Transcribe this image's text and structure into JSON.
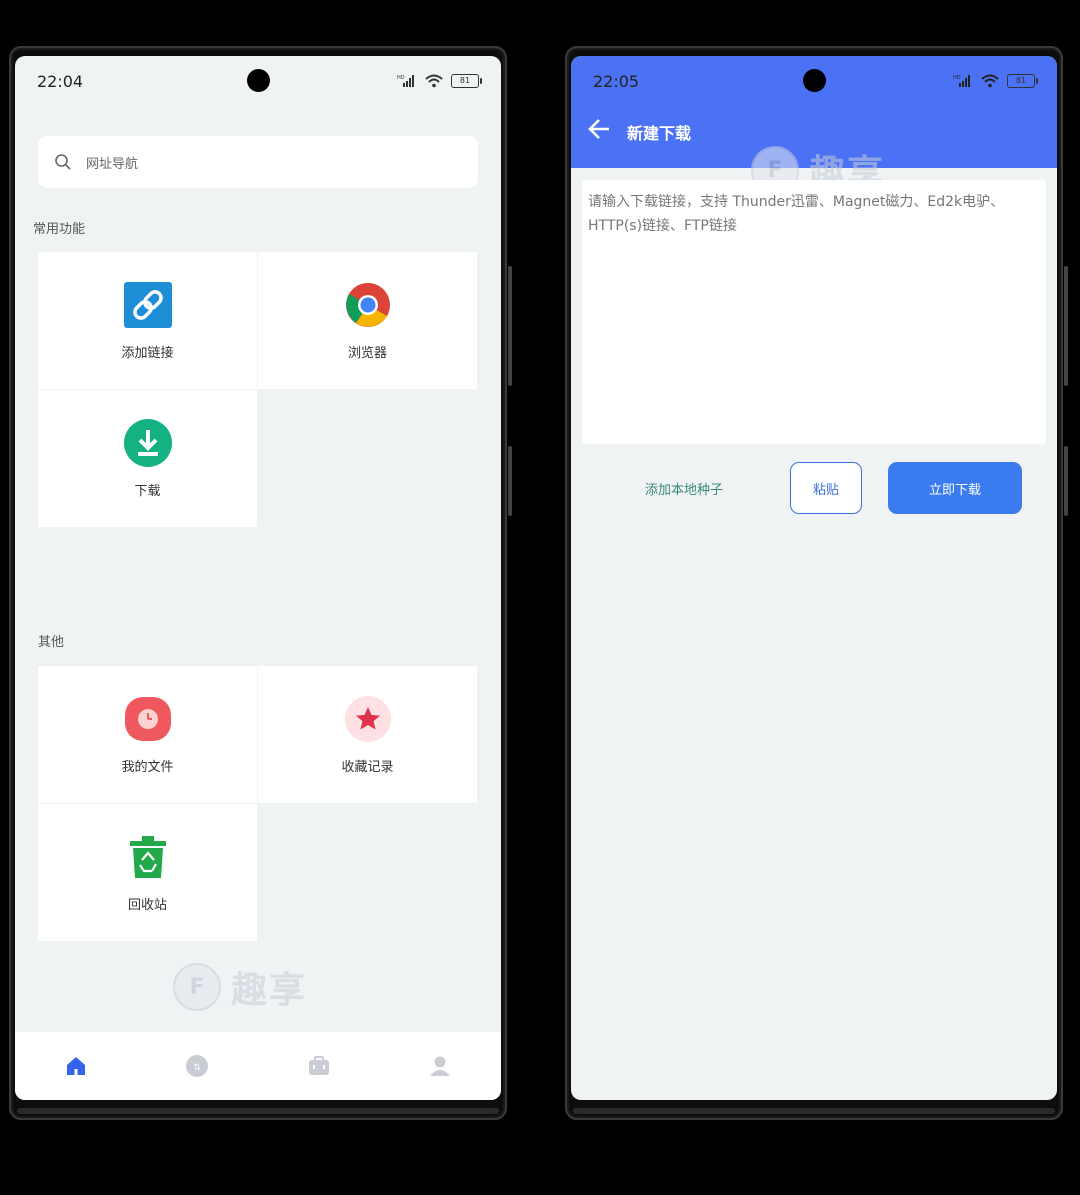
{
  "left_phone": {
    "status": {
      "time": "22:04",
      "battery": "81"
    },
    "search": {
      "placeholder": "网址导航"
    },
    "common_section": {
      "title": "常用功能",
      "items": [
        {
          "label": "添加链接",
          "icon": "link-icon"
        },
        {
          "label": "浏览器",
          "icon": "chrome-icon"
        },
        {
          "label": "下载",
          "icon": "download-icon"
        }
      ]
    },
    "other_section": {
      "title": "其他",
      "items": [
        {
          "label": "我的文件",
          "icon": "clock-icon"
        },
        {
          "label": "收藏记录",
          "icon": "star-icon"
        },
        {
          "label": "回收站",
          "icon": "recycle-bin-icon"
        }
      ]
    },
    "bottom_nav": [
      "home-icon",
      "tools-icon",
      "briefcase-icon",
      "profile-icon"
    ],
    "watermark": "趣享"
  },
  "right_phone": {
    "status": {
      "time": "22:05",
      "battery": "81"
    },
    "appbar": {
      "title": "新建下载"
    },
    "link_input": {
      "placeholder": "请输入下载链接，支持 Thunder迅雷、Magnet磁力、Ed2k电驴、HTTP(s)链接、FTP链接"
    },
    "actions": {
      "add_torrent": "添加本地种子",
      "paste": "粘贴",
      "download_now": "立即下载"
    },
    "watermark": "趣享"
  },
  "colors": {
    "accent_blue": "#4b72f5",
    "button_blue": "#3a7cf0",
    "screen_bg": "#eff3f3"
  }
}
